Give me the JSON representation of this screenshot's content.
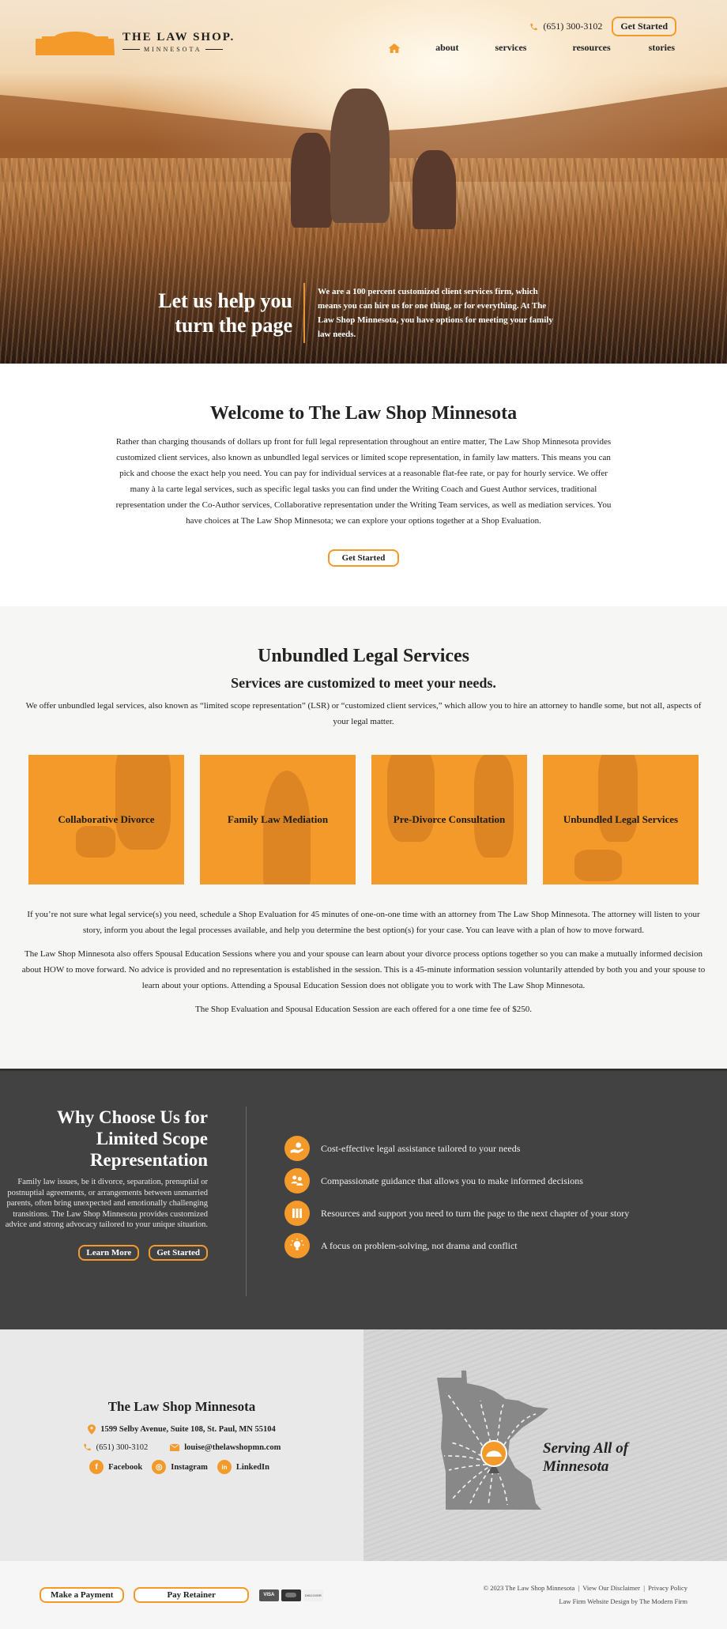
{
  "header": {
    "logo_title": "THE LAW SHOP.",
    "logo_sub": "MINNESOTA",
    "phone": "(651) 300-3102",
    "cta": "Get Started",
    "nav": [
      {
        "label": "home",
        "icon": "home-icon"
      },
      {
        "label": "about"
      },
      {
        "label": "services"
      },
      {
        "label": "resources"
      },
      {
        "label": "stories"
      }
    ]
  },
  "hero": {
    "heading_line1": "Let us help you",
    "heading_line2": "turn the page",
    "text": "We are a 100 percent customized client services firm, which means you can hire us for one thing, or for everything. At The Law Shop Minnesota, you have options for meeting your family law needs."
  },
  "welcome": {
    "title": "Welcome to The Law Shop Minnesota",
    "text": "Rather than charging thousands of dollars up front for full legal representation throughout an entire matter, The Law Shop Minnesota provides customized client services, also known as unbundled legal services or limited scope representation, in family law matters. This means you can pick and choose the exact help you need. You can pay for individual services at a reasonable flat-fee rate, or pay for hourly service. We offer many à la carte legal services, such as specific legal tasks you can find under the Writing Coach and Guest Author services, traditional representation under the Co-Author services, Collaborative representation under the Writing Team services, as well as mediation services. You have choices at The Law Shop Minnesota; we can explore your options together at a Shop Evaluation.",
    "cta": "Get Started"
  },
  "services": {
    "title": "Unbundled Legal Services",
    "subtitle": "Services are customized to meet your needs.",
    "intro": "We offer unbundled legal services, also known as “limited scope representation” (LSR) or “customized client services,” which allow you to hire an attorney to handle some, but not all, aspects of your legal matter.",
    "cards": [
      {
        "label": "Collaborative Divorce"
      },
      {
        "label": "Family Law Mediation"
      },
      {
        "label": "Pre-Divorce Consultation"
      },
      {
        "label": "Unbundled Legal Services"
      }
    ],
    "paragraphs": [
      "If you’re not sure what legal service(s) you need, schedule a Shop Evaluation for 45 minutes of one-on-one time with an attorney from The Law Shop Minnesota. The attorney will listen to your story, inform you about the legal processes available, and help you determine the best option(s) for your case. You can leave with a plan of how to move forward.",
      "The Law Shop Minnesota also offers Spousal Education Sessions where you and your spouse can learn about your divorce process options together so you can make a mutually informed decision about HOW to move forward. No advice is provided and no representation is established in the session. This is a 45-minute information session voluntarily attended by both you and your spouse to learn about your options. Attending a Spousal Education Session does not obligate you to work with The Law Shop Minnesota.",
      "The Shop Evaluation and Spousal Education Session are each offered for a one time fee of $250."
    ]
  },
  "why": {
    "title": "Why Choose Us for Limited Scope Representation",
    "text": "Family law issues, be it divorce, separation, prenuptial or postnuptial agreements, or arrangements between unmarried parents, often bring unexpected and emotionally challenging transitions. The Law Shop Minnesota provides customized advice and strong advocacy tailored to your unique situation.",
    "learn_more": "Learn More",
    "get_started": "Get Started",
    "items": [
      {
        "icon": "money-hand-icon",
        "text": "Cost-effective legal assistance tailored to your needs"
      },
      {
        "icon": "people-icon",
        "text": "Compassionate guidance that allows you to make informed decisions"
      },
      {
        "icon": "books-icon",
        "text": "Resources and support you need to turn the page to the next chapter of your story"
      },
      {
        "icon": "lightbulb-icon",
        "text": "A focus on problem-solving, not drama and conflict"
      }
    ]
  },
  "contact": {
    "title": "The Law Shop Minnesota",
    "address": "1599 Selby Avenue, Suite 108, St. Paul, MN 55104",
    "phone": "(651) 300-3102",
    "email": "louise@thelawshopmn.com",
    "social": [
      {
        "label": "Facebook",
        "glyph": "f"
      },
      {
        "label": "Instagram",
        "glyph": "◎"
      },
      {
        "label": "LinkedIn",
        "glyph": "in"
      }
    ],
    "map_label_line1": "Serving All of",
    "map_label_line2": "Minnesota"
  },
  "footer": {
    "make_payment": "Make a Payment",
    "pay_retainer": "Pay Retainer",
    "cards": [
      "VISA",
      "MC",
      "DISCOVER"
    ],
    "copyright": "© 2023 The Law Shop Minnesota",
    "disclaimer": "View Our Disclaimer",
    "privacy": "Privacy Policy",
    "credit": "Law Firm Website Design by The Modern Firm"
  },
  "colors": {
    "accent": "#f39a2b",
    "dark_section": "#424242",
    "light_section": "#f6f6f4"
  }
}
